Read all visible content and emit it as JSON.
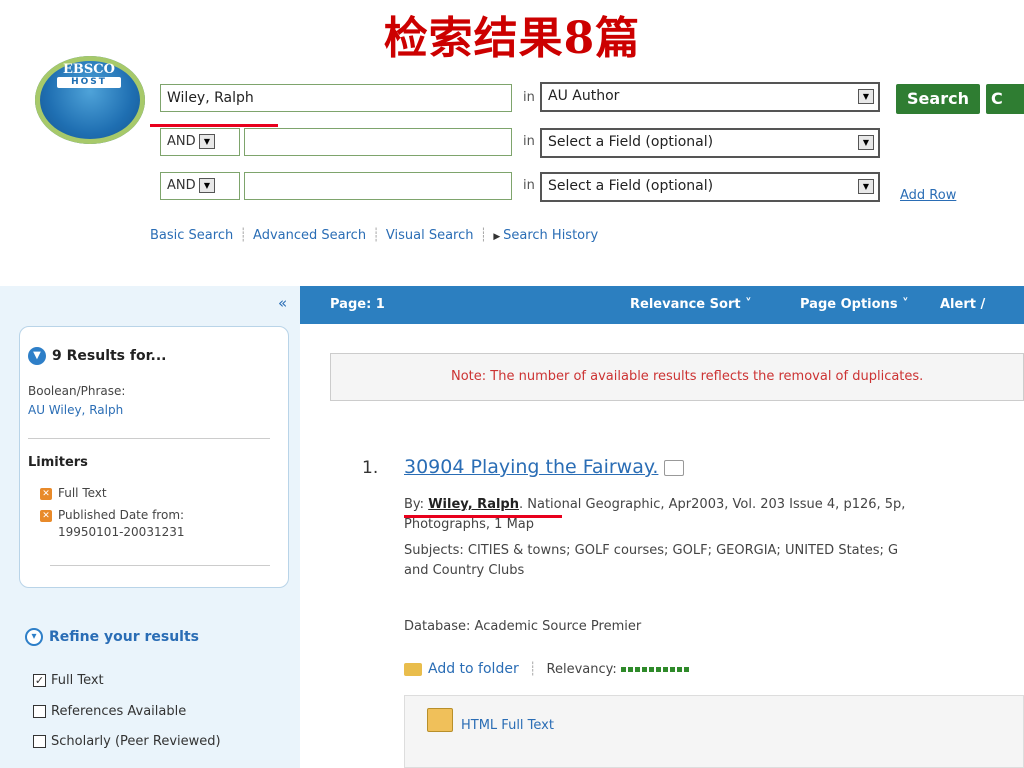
{
  "slide_title": "检索结果8篇",
  "logo": {
    "line1": "EBSCO",
    "line2": "HOST"
  },
  "search": {
    "rows": [
      {
        "term": "Wiley, Ralph",
        "bool": "",
        "field": "AU Author"
      },
      {
        "term": "",
        "bool": "AND",
        "field": "Select a Field (optional)"
      },
      {
        "term": "",
        "bool": "AND",
        "field": "Select a Field (optional)"
      }
    ],
    "in_label": "in",
    "search_button": "Search",
    "clear_button": "C",
    "add_row": "Add Row",
    "links": [
      "Basic Search",
      "Advanced Search",
      "Visual Search",
      "Search History"
    ]
  },
  "sidebar": {
    "collapse": "«",
    "results_title": "9 Results for...",
    "bool_label": "Boolean/Phrase:",
    "bool_value": "AU Wiley, Ralph",
    "limiters_title": "Limiters",
    "limiters": [
      "Full Text",
      "Published Date from:",
      "19950101-20031231"
    ],
    "refine_title": "Refine your results",
    "refine_options": [
      {
        "label": "Full Text",
        "checked": true
      },
      {
        "label": "References Available",
        "checked": false
      },
      {
        "label": "Scholarly (Peer Reviewed)",
        "checked": false
      }
    ]
  },
  "toolbar": {
    "page": "Page: 1",
    "sort": "Relevance Sort ˅",
    "options": "Page Options ˅",
    "alert": "Alert /"
  },
  "note": "Note: The number of available results reflects the removal of duplicates.",
  "result": {
    "number": "1.",
    "title": "30904 Playing the Fairway.",
    "by_label": "By: ",
    "author": "Wiley, Ralph",
    "by_rest": ". National Geographic, Apr2003, Vol. 203 Issue 4, p126, 5p,",
    "by_line2": "Photographs, 1 Map",
    "subjects_line1": "Subjects: CITIES & towns; GOLF courses; GOLF; GEORGIA; UNITED States; G",
    "subjects_line2": "and Country Clubs",
    "database": "Database: Academic Source Premier",
    "add_folder": "Add to folder",
    "relevancy": "Relevancy:",
    "full_text": "HTML Full Text"
  }
}
